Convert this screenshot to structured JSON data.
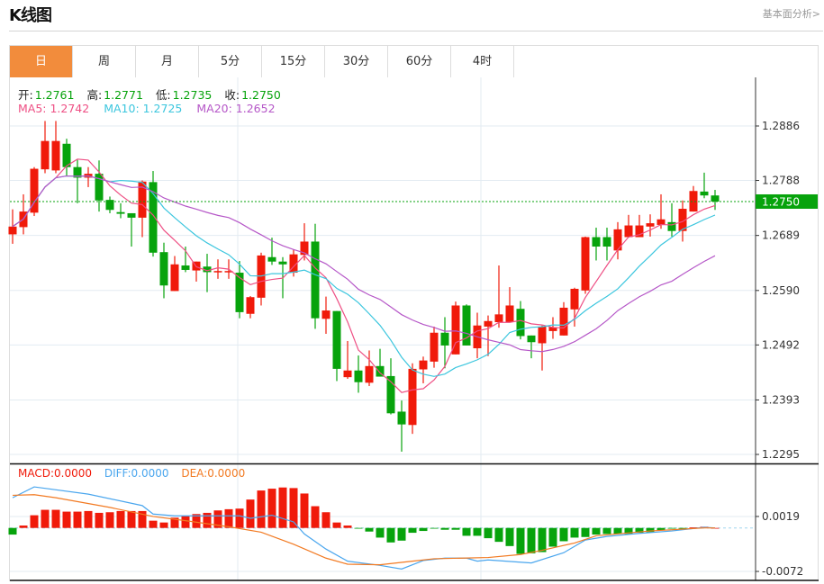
{
  "header": {
    "title": "K线图",
    "link": "基本面分析>"
  },
  "tabs": [
    {
      "label": "日",
      "active": true
    },
    {
      "label": "周"
    },
    {
      "label": "月"
    },
    {
      "label": "5分"
    },
    {
      "label": "15分"
    },
    {
      "label": "30分"
    },
    {
      "label": "60分"
    },
    {
      "label": "4时"
    }
  ],
  "ohlc_legend": {
    "open_label": "开:",
    "open": "1.2761",
    "high_label": "高:",
    "high": "1.2771",
    "low_label": "低:",
    "low": "1.2735",
    "close_label": "收:",
    "close": "1.2750"
  },
  "ma_legend": {
    "ma5": "MA5: 1.2742",
    "ma10": "MA10: 1.2725",
    "ma20": "MA20: 1.2652"
  },
  "macd_legend": {
    "macd": "MACD:0.0000",
    "diff": "DIFF:0.0000",
    "dea": "DEA:0.0000"
  },
  "colors": {
    "up": "#f01a0a",
    "down": "#07a30c",
    "ma5": "#ee4f84",
    "ma10": "#3cc6de",
    "ma20": "#b658c8",
    "diff": "#4aa6ee",
    "dea": "#f27a22",
    "accent": "#f28c3c"
  },
  "chart_data": [
    {
      "type": "candlestick",
      "title": "K线图",
      "ylim": [
        1.2295,
        1.2886
      ],
      "yticks": [
        "1.2886",
        "1.2788",
        "1.2689",
        "1.2590",
        "1.2492",
        "1.2393",
        "1.2295"
      ],
      "last_price": "1.2750",
      "ohlc": [
        [
          1.2691,
          1.2736,
          1.2674,
          1.2705
        ],
        [
          1.2704,
          1.2763,
          1.2691,
          1.2732
        ],
        [
          1.273,
          1.2812,
          1.2724,
          1.2809
        ],
        [
          1.2808,
          1.2895,
          1.2801,
          1.2859
        ],
        [
          1.2806,
          1.2895,
          1.2801,
          1.2859
        ],
        [
          1.2854,
          1.2863,
          1.2796,
          1.2812
        ],
        [
          1.2812,
          1.2825,
          1.2747,
          1.2793
        ],
        [
          1.2793,
          1.2812,
          1.2776,
          1.28
        ],
        [
          1.28,
          1.2824,
          1.2732,
          1.2752
        ],
        [
          1.2753,
          1.2759,
          1.2729,
          1.2735
        ],
        [
          1.2731,
          1.2747,
          1.272,
          1.2728
        ],
        [
          1.2729,
          1.2729,
          1.2669,
          1.2721
        ],
        [
          1.2721,
          1.2788,
          1.2686,
          1.2786
        ],
        [
          1.2785,
          1.2805,
          1.2651,
          1.2658
        ],
        [
          1.2659,
          1.2676,
          1.2576,
          1.2599
        ],
        [
          1.2589,
          1.2652,
          1.2589,
          1.2637
        ],
        [
          1.2635,
          1.2669,
          1.2623,
          1.2627
        ],
        [
          1.2626,
          1.2642,
          1.2606,
          1.2642
        ],
        [
          1.2633,
          1.2656,
          1.2587,
          1.2623
        ],
        [
          1.2623,
          1.2646,
          1.2611,
          1.2625
        ],
        [
          1.2623,
          1.2646,
          1.2611,
          1.2625
        ],
        [
          1.2622,
          1.2643,
          1.254,
          1.2551
        ],
        [
          1.2548,
          1.258,
          1.254,
          1.2578
        ],
        [
          1.2577,
          1.2658,
          1.2563,
          1.2653
        ],
        [
          1.265,
          1.2685,
          1.2636,
          1.2642
        ],
        [
          1.2642,
          1.265,
          1.2576,
          1.2637
        ],
        [
          1.2622,
          1.2664,
          1.2615,
          1.2655
        ],
        [
          1.2654,
          1.2711,
          1.2644,
          1.2678
        ],
        [
          1.2678,
          1.271,
          1.2521,
          1.254
        ],
        [
          1.2539,
          1.2579,
          1.2512,
          1.2554
        ],
        [
          1.2553,
          1.2553,
          1.2427,
          1.2449
        ],
        [
          1.2434,
          1.2499,
          1.2431,
          1.2446
        ],
        [
          1.2446,
          1.2473,
          1.2406,
          1.2425
        ],
        [
          1.2424,
          1.2482,
          1.2418,
          1.2454
        ],
        [
          1.2454,
          1.2485,
          1.2435,
          1.2435
        ],
        [
          1.2436,
          1.2468,
          1.2367,
          1.2369
        ],
        [
          1.2372,
          1.2392,
          1.23,
          1.2349
        ],
        [
          1.2348,
          1.2459,
          1.2332,
          1.2449
        ],
        [
          1.2448,
          1.2471,
          1.2423,
          1.2464
        ],
        [
          1.2462,
          1.2525,
          1.2451,
          1.2514
        ],
        [
          1.2514,
          1.2542,
          1.245,
          1.2491
        ],
        [
          1.2475,
          1.257,
          1.2475,
          1.2563
        ],
        [
          1.2563,
          1.2565,
          1.2491,
          1.2491
        ],
        [
          1.2486,
          1.255,
          1.2468,
          1.2527
        ],
        [
          1.2525,
          1.2545,
          1.2472,
          1.2535
        ],
        [
          1.2533,
          1.2635,
          1.2523,
          1.2547
        ],
        [
          1.2533,
          1.2596,
          1.2533,
          1.2563
        ],
        [
          1.2557,
          1.2571,
          1.2502,
          1.2508
        ],
        [
          1.2509,
          1.2509,
          1.2468,
          1.2497
        ],
        [
          1.2495,
          1.2527,
          1.2446,
          1.2525
        ],
        [
          1.2517,
          1.2542,
          1.2503,
          1.2524
        ],
        [
          1.2509,
          1.2569,
          1.2509,
          1.2559
        ],
        [
          1.2556,
          1.2595,
          1.2525,
          1.2593
        ],
        [
          1.259,
          1.2687,
          1.2584,
          1.2686
        ],
        [
          1.2686,
          1.2703,
          1.2644,
          1.2669
        ],
        [
          1.2686,
          1.2703,
          1.2644,
          1.2669
        ],
        [
          1.2662,
          1.2713,
          1.2646,
          1.27
        ],
        [
          1.2686,
          1.2726,
          1.2686,
          1.2707
        ],
        [
          1.2686,
          1.2726,
          1.2686,
          1.2707
        ],
        [
          1.2705,
          1.2727,
          1.2687,
          1.2711
        ],
        [
          1.2708,
          1.2763,
          1.2701,
          1.2718
        ],
        [
          1.2713,
          1.2747,
          1.2687,
          1.2697
        ],
        [
          1.2697,
          1.2752,
          1.2678,
          1.2737
        ],
        [
          1.2732,
          1.2778,
          1.2732,
          1.2769
        ],
        [
          1.2768,
          1.2802,
          1.2756,
          1.2761
        ],
        [
          1.2761,
          1.2771,
          1.2735,
          1.275
        ]
      ],
      "ma_periods": [
        5,
        10,
        20
      ]
    },
    {
      "type": "bar",
      "title": "MACD",
      "ylim": [
        -0.008,
        0.006
      ],
      "yticks": [
        "0.0019",
        "-0.0072"
      ],
      "macd": [
        -0.0011,
        0.0004,
        0.0021,
        0.003,
        0.003,
        0.0027,
        0.0027,
        0.0028,
        0.0025,
        0.0026,
        0.0028,
        0.0028,
        0.0028,
        0.0012,
        0.0009,
        0.0017,
        0.002,
        0.0023,
        0.0025,
        0.0029,
        0.0031,
        0.0032,
        0.0047,
        0.0062,
        0.0065,
        0.0067,
        0.0066,
        0.0057,
        0.0036,
        0.0026,
        0.0009,
        0.0004,
        -0.0001,
        -0.0006,
        -0.0016,
        -0.0024,
        -0.0021,
        -0.0008,
        -0.0005,
        -0.0001,
        -0.0003,
        -0.0003,
        -0.0013,
        -0.0013,
        -0.0017,
        -0.0023,
        -0.003,
        -0.0043,
        -0.0042,
        -0.004,
        -0.0031,
        -0.0022,
        -0.0016,
        -0.0015,
        -0.0011,
        -0.001,
        -0.001,
        -0.001,
        -0.0008,
        -0.0007,
        -0.0004,
        -0.0001,
        -0.0001,
        0.0001,
        0.0002,
        0.0
      ],
      "diff": [
        [
          1,
          0.005
        ],
        [
          3,
          0.0068
        ],
        [
          8,
          0.0056
        ],
        [
          13,
          0.0037
        ],
        [
          14,
          0.0023
        ],
        [
          16,
          0.002
        ],
        [
          22,
          0.002
        ],
        [
          23,
          0.0016
        ],
        [
          25,
          0.0021
        ],
        [
          27,
          0.001
        ],
        [
          28,
          -0.001
        ],
        [
          30,
          -0.0035
        ],
        [
          32,
          -0.0055
        ],
        [
          35,
          -0.0062
        ],
        [
          37,
          -0.0068
        ],
        [
          39,
          -0.0054
        ],
        [
          41,
          -0.005
        ],
        [
          43,
          -0.005
        ],
        [
          44,
          -0.0055
        ],
        [
          45,
          -0.0053
        ],
        [
          49,
          -0.0058
        ],
        [
          52,
          -0.0041
        ],
        [
          54,
          -0.002
        ],
        [
          56,
          -0.0014
        ],
        [
          59,
          -0.0009
        ],
        [
          62,
          -0.0005
        ],
        [
          65,
          0.0001
        ],
        [
          66,
          0.0
        ]
      ],
      "dea": [
        [
          1,
          0.0054
        ],
        [
          3,
          0.0055
        ],
        [
          5,
          0.005
        ],
        [
          10,
          0.0034
        ],
        [
          14,
          0.0019
        ],
        [
          17,
          0.0012
        ],
        [
          21,
          0.0002
        ],
        [
          24,
          -0.0007
        ],
        [
          27,
          -0.0027
        ],
        [
          30,
          -0.005
        ],
        [
          32,
          -0.006
        ],
        [
          35,
          -0.0061
        ],
        [
          38,
          -0.0055
        ],
        [
          40,
          -0.0051
        ],
        [
          45,
          -0.0049
        ],
        [
          48,
          -0.0044
        ],
        [
          50,
          -0.0037
        ],
        [
          53,
          -0.0025
        ],
        [
          55,
          -0.0013
        ],
        [
          60,
          -0.0005
        ],
        [
          65,
          0.0
        ],
        [
          66,
          0.0
        ]
      ]
    }
  ]
}
